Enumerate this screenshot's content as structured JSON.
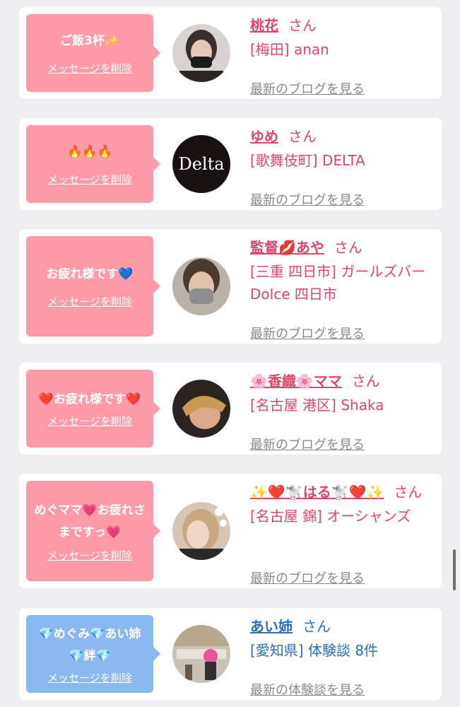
{
  "cards": [
    {
      "message": "ご飯3杯✨",
      "delete_label": "メッセージを削除",
      "name": "桃花",
      "san": "さん",
      "shop": "[梅田] anan",
      "link": "最新のブログを見る"
    },
    {
      "message": "🔥🔥🔥",
      "delete_label": "メッセージを削除",
      "name": "ゆめ",
      "san": "さん",
      "shop": "[歌舞伎町] DELTA",
      "link": "最新のブログを見る",
      "logo_text": "Delta"
    },
    {
      "message": "お疲れ様です💙",
      "delete_label": "メッセージを削除",
      "name": "監督💋あや",
      "san": "さん",
      "shop": "[三重 四日市] ガールズバー Dolce 四日市",
      "link": "最新のブログを見る"
    },
    {
      "message": "❤️お疲れ様です❤️",
      "delete_label": "メッセージを削除",
      "name": "🌸香織🌸ママ",
      "san": "さん",
      "shop": "[名古屋 港区] Shaka",
      "link": "最新のブログを見る"
    },
    {
      "message": "めぐママ💗お疲れさまですっ💗",
      "delete_label": "メッセージを削除",
      "name": "✨❤️🐩はる🐩❤️✨",
      "san": "さん",
      "shop": "[名古屋 錦] オーシャンズ",
      "link": "最新のブログを見る"
    },
    {
      "message": "💎めぐみ💎あい姉💎絆💎",
      "delete_label": "メッセージを削除",
      "name": "あい姉",
      "san": "さん",
      "shop": "[愛知県] 体験談 8件",
      "link": "最新の体験談を見る"
    }
  ],
  "colors": {
    "pink_bubble": "#ff9aa8",
    "blue_bubble": "#8ab8f0",
    "pink_text": "#e0446a",
    "blue_text": "#2a6fb8",
    "link_gray": "#8a8a8a"
  }
}
